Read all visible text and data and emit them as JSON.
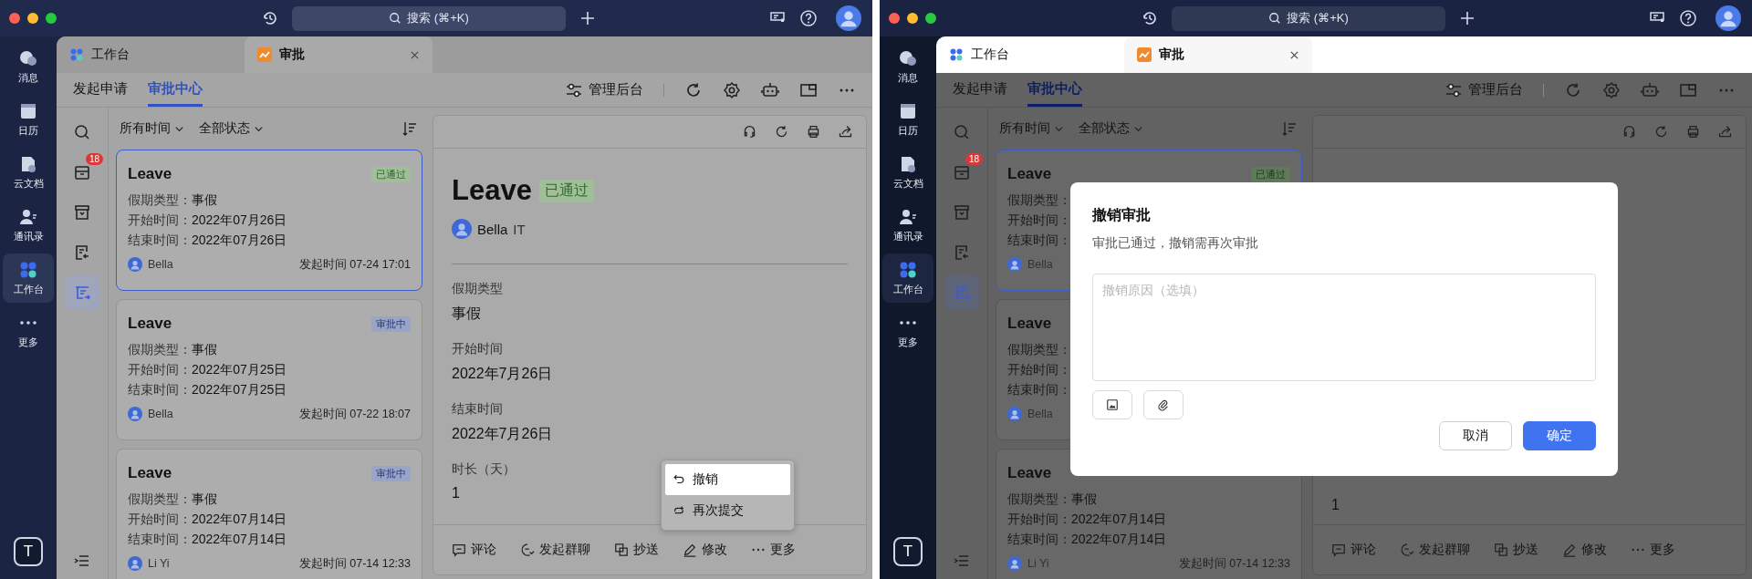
{
  "windows": [
    {
      "kind": "menu",
      "search": {
        "placeholder": "搜索 (⌘+K)"
      },
      "nav": [
        {
          "kind": "chat",
          "label": "消息",
          "selected": false
        },
        {
          "kind": "calendar",
          "label": "日历",
          "selected": false
        },
        {
          "kind": "docs",
          "label": "云文档",
          "selected": false
        },
        {
          "kind": "contacts",
          "label": "通讯录",
          "selected": false
        },
        {
          "kind": "apps",
          "label": "工作台",
          "selected": true
        },
        {
          "kind": "more",
          "label": "更多",
          "selected": false
        }
      ],
      "user_initial": "T",
      "tabs": [
        {
          "kind": "apps",
          "label": "工作台",
          "selected": false
        },
        {
          "kind": "approval",
          "label": "审批",
          "selected": true
        }
      ],
      "subtabs": [
        {
          "label": "发起申请",
          "selected": false
        },
        {
          "label": "审批中心",
          "selected": true
        }
      ],
      "admin_button": "管理后台",
      "tools": [
        {
          "kind": "search",
          "selected": false
        },
        {
          "kind": "inbox",
          "selected": false,
          "badge": "18"
        },
        {
          "kind": "archive",
          "selected": false
        },
        {
          "kind": "form",
          "selected": false
        },
        {
          "kind": "approval",
          "selected": true
        }
      ],
      "filters": [
        "所有时间",
        "全部状态"
      ],
      "cards": [
        {
          "title": "Leave",
          "status": "已通过",
          "kind": "approved",
          "selected": true,
          "rows": [
            {
              "label": "假期类型：",
              "value": "事假"
            },
            {
              "label": "开始时间：",
              "value": "2022年07月26日"
            },
            {
              "label": "结束时间：",
              "value": "2022年07月26日"
            }
          ],
          "user": "Bella",
          "time": "发起时间 07-24 17:01"
        },
        {
          "title": "Leave",
          "status": "审批中",
          "kind": "pending",
          "selected": false,
          "rows": [
            {
              "label": "假期类型：",
              "value": "事假"
            },
            {
              "label": "开始时间：",
              "value": "2022年07月25日"
            },
            {
              "label": "结束时间：",
              "value": "2022年07月25日"
            }
          ],
          "user": "Bella",
          "time": "发起时间 07-22 18:07"
        },
        {
          "title": "Leave",
          "status": "审批中",
          "kind": "pending",
          "selected": false,
          "rows": [
            {
              "label": "假期类型：",
              "value": "事假"
            },
            {
              "label": "开始时间：",
              "value": "2022年07月14日"
            },
            {
              "label": "结束时间：",
              "value": "2022年07月14日"
            }
          ],
          "user": "Li Yi",
          "time": "发起时间 07-14 12:33"
        }
      ],
      "detail": {
        "title": "Leave",
        "status": "已通过",
        "kind": "approved",
        "user": "Bella",
        "dept": "IT",
        "fields": [
          {
            "label": "假期类型",
            "value": "事假"
          },
          {
            "label": "开始时间",
            "value": "2022年7月26日"
          },
          {
            "label": "结束时间",
            "value": "2022年7月26日"
          },
          {
            "label": "时长（天）",
            "value": "1"
          }
        ]
      },
      "actions": [
        {
          "kind": "comment",
          "label": "评论"
        },
        {
          "kind": "chat",
          "label": "发起群聊"
        },
        {
          "kind": "cc",
          "label": "抄送"
        },
        {
          "kind": "edit",
          "label": "修改"
        },
        {
          "kind": "more",
          "label": "更多"
        }
      ],
      "menu": [
        {
          "kind": "undo",
          "label": "撤销",
          "selected": true
        },
        {
          "kind": "resubmit",
          "label": "再次提交",
          "selected": false
        }
      ]
    },
    {
      "kind": "dialog",
      "search": {
        "placeholder": "搜索 (⌘+K)"
      },
      "nav": [
        {
          "kind": "chat",
          "label": "消息",
          "selected": false
        },
        {
          "kind": "calendar",
          "label": "日历",
          "selected": false
        },
        {
          "kind": "docs",
          "label": "云文档",
          "selected": false
        },
        {
          "kind": "contacts",
          "label": "通讯录",
          "selected": false
        },
        {
          "kind": "apps",
          "label": "工作台",
          "selected": true
        },
        {
          "kind": "more",
          "label": "更多",
          "selected": false
        }
      ],
      "user_initial": "T",
      "tabs": [
        {
          "kind": "apps",
          "label": "工作台",
          "selected": false
        },
        {
          "kind": "approval",
          "label": "审批",
          "selected": true
        }
      ],
      "subtabs": [
        {
          "label": "发起申请",
          "selected": false
        },
        {
          "label": "审批中心",
          "selected": true
        }
      ],
      "admin_button": "管理后台",
      "tools": [
        {
          "kind": "search",
          "selected": false
        },
        {
          "kind": "inbox",
          "selected": false,
          "badge": "18"
        },
        {
          "kind": "archive",
          "selected": false
        },
        {
          "kind": "form",
          "selected": false
        },
        {
          "kind": "approval",
          "selected": true
        }
      ],
      "filters": [
        "所有时间",
        "全部状态"
      ],
      "cards": [
        {
          "title": "Leave",
          "status": "已通过",
          "kind": "approved",
          "selected": true,
          "rows": [
            {
              "label": "假期类型："
            },
            {
              "label": "开始时间："
            },
            {
              "label": "结束时间："
            }
          ],
          "user": "Bella"
        },
        {
          "title": "Leave",
          "selected": false,
          "rows": [
            {
              "label": "假期类型："
            },
            {
              "label": "开始时间："
            },
            {
              "label": "结束时间："
            }
          ],
          "user": "Bella"
        },
        {
          "title": "Leave",
          "selected": false,
          "rows": [
            {
              "label": "假期类型：",
              "value": "事假"
            },
            {
              "label": "开始时间：",
              "value": "2022年07月14日"
            },
            {
              "label": "结束时间：",
              "value": "2022年07月14日"
            }
          ],
          "user": "Li Yi",
          "time": "发起时间 07-14 12:33"
        }
      ],
      "detail": {
        "fields": [
          {
            "value": "1"
          }
        ]
      },
      "actions": [
        {
          "kind": "comment",
          "label": "评论"
        },
        {
          "kind": "chat",
          "label": "发起群聊"
        },
        {
          "kind": "cc",
          "label": "抄送"
        },
        {
          "kind": "edit",
          "label": "修改"
        },
        {
          "kind": "more",
          "label": "更多"
        }
      ],
      "dialog": {
        "title": "撤销审批",
        "message": "审批已通过，撤销需再次审批",
        "placeholder": "撤销原因（选填）",
        "buttons": [
          {
            "kind": "cancel",
            "label": "取消"
          },
          {
            "kind": "confirm",
            "label": "确定"
          }
        ]
      }
    }
  ]
}
